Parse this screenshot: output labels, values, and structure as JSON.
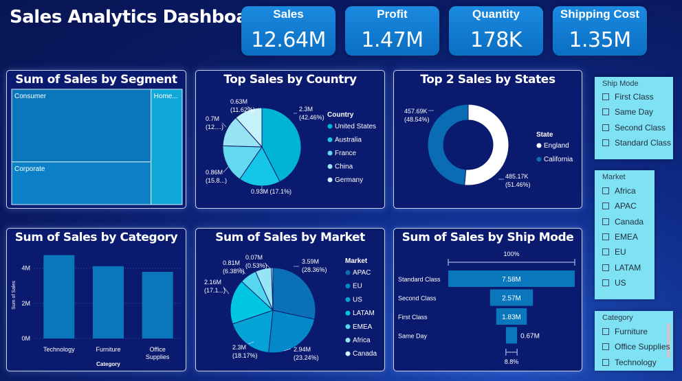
{
  "dashboard_title": "Sales Analytics Dashboard",
  "colors": {
    "background": "#0a1a63",
    "card": "#0a1a6e",
    "kpi": "#0a6fc3",
    "slicer": "#7fe1f4",
    "treemap_main": "#0a77bd",
    "treemap_side": "#10a8d8"
  },
  "kpis": [
    {
      "label": "Sales",
      "value": "12.64M"
    },
    {
      "label": "Profit",
      "value": "1.47M"
    },
    {
      "label": "Quantity",
      "value": "178K"
    },
    {
      "label": "Shipping Cost",
      "value": "1.35M"
    }
  ],
  "filters": [
    {
      "title": "Ship Mode",
      "options": [
        "First Class",
        "Same Day",
        "Second Class",
        "Standard Class"
      ]
    },
    {
      "title": "Market",
      "options": [
        "Africa",
        "APAC",
        "Canada",
        "EMEA",
        "EU",
        "LATAM",
        "US"
      ]
    },
    {
      "title": "Category",
      "options": [
        "Furniture",
        "Office Supplies",
        "Technology"
      ]
    }
  ],
  "chart_data": [
    {
      "type": "treemap",
      "title": "Sum of Sales by Segment",
      "categories": [
        "Consumer",
        "Corporate",
        "Home..."
      ],
      "values": [
        6.51,
        3.82,
        2.31
      ]
    },
    {
      "type": "pie",
      "title": "Top Sales by Country",
      "legend_title": "Country",
      "legend_position": "right",
      "categories": [
        "United States",
        "Australia",
        "France",
        "China",
        "Germany"
      ],
      "values": [
        2.3,
        0.93,
        0.86,
        0.7,
        0.63
      ],
      "percentages": [
        42.46,
        17.1,
        15.8,
        12.9,
        11.62
      ],
      "data_labels": [
        [
          "2.3M",
          "(42.46%)"
        ],
        [
          "0.93M (17.1%)"
        ],
        [
          "0.86M",
          "(15.8...)"
        ],
        [
          "0.7M",
          "(12....)"
        ],
        [
          "0.63M",
          "(11.62%)"
        ]
      ]
    },
    {
      "type": "donut",
      "title": "Top 2 Sales by States",
      "legend_title": "State",
      "legend_position": "right",
      "categories": [
        "England",
        "California"
      ],
      "values": [
        485.17,
        457.69
      ],
      "unit": "K",
      "percentages": [
        51.46,
        48.54
      ],
      "data_labels": [
        [
          "485.17K",
          "(51.46%)"
        ],
        [
          "457.69K",
          "(48.54%)"
        ]
      ]
    },
    {
      "type": "bar",
      "title": "Sum of Sales by Category",
      "xlabel": "Category",
      "ylabel": "Sum of Sales",
      "categories": [
        "Technology",
        "Furniture",
        "Office Supplies"
      ],
      "category_lines": [
        [
          "Technology"
        ],
        [
          "Furniture"
        ],
        [
          "Office",
          "Supplies"
        ]
      ],
      "values": [
        4.74,
        4.11,
        3.79
      ],
      "ylim": [
        0,
        5
      ],
      "yticks": [
        0,
        2,
        4
      ],
      "ytick_labels": [
        "0M",
        "2M",
        "4M"
      ],
      "grid": true
    },
    {
      "type": "pie",
      "title": "Sum of Sales by Market",
      "legend_title": "Market",
      "legend_position": "right",
      "categories": [
        "APAC",
        "EU",
        "US",
        "LATAM",
        "EMEA",
        "Africa",
        "Canada"
      ],
      "values": [
        3.59,
        2.94,
        2.3,
        2.16,
        0.81,
        0.78,
        0.07
      ],
      "percentages": [
        28.36,
        23.24,
        18.17,
        17.1,
        6.38,
        6.2,
        0.53
      ],
      "data_labels": [
        [
          "3.59M",
          "(28.36%)"
        ],
        [
          "2.94M",
          "(23.24%)"
        ],
        [
          "2.3M",
          "(18.17%)"
        ],
        [
          "2.16M",
          "(17.1...)"
        ],
        [
          "0.81M",
          "(6.38%)"
        ],
        [],
        [
          "0.07M",
          "(0.53%)"
        ]
      ]
    },
    {
      "type": "funnel",
      "title": "Sum of Sales by Ship Mode",
      "categories": [
        "Standard Class",
        "Second Class",
        "First Class",
        "Same Day"
      ],
      "values": [
        7.58,
        2.57,
        1.83,
        0.67
      ],
      "data_labels": [
        "7.58M",
        "2.57M",
        "1.83M",
        "0.67M"
      ],
      "top_percent": "100%",
      "bottom_percent": "8.8%"
    }
  ]
}
